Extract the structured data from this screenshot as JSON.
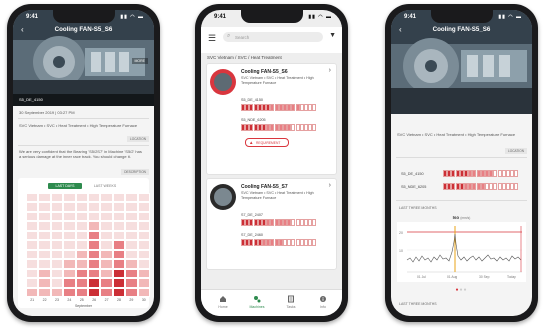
{
  "status": {
    "time": "9:41",
    "icons": "▮▮ ◠ ▬"
  },
  "colors": {
    "accent": "#d9363e",
    "light_red": "#f2b8b8",
    "mid_red": "#e87f84",
    "dark_red": "#cc2f36",
    "green": "#2e8b4e"
  },
  "phone1": {
    "title": "Cooling FAN-S5_S6",
    "back": "‹",
    "more": "MORE",
    "photo_caption": "S5_DE_4150",
    "date": "30 September 2019 | 03:27 PM",
    "location_text": "SVC Vietnam • SVC • Heat Treatment • High Temperature Furnace",
    "location_btn": "LOCATION",
    "desc_text": "We are very confident that the Bearing 'S5/2S7' in Machine 'S5/2' has a serious damage at the inner race track. You should change it.",
    "desc_btn": "DESCRIPTION",
    "tabs": [
      "LAST DAYS",
      "LAST WEEKS"
    ],
    "x_labels": [
      "21",
      "22",
      "23",
      "24",
      "25",
      "26",
      "27",
      "28",
      "29",
      "30"
    ],
    "x_title": "September",
    "heat_columns": [
      [
        0,
        0,
        0,
        0,
        0,
        0,
        0,
        0,
        0,
        0,
        1
      ],
      [
        0,
        0,
        0,
        0,
        0,
        0,
        0,
        0,
        1,
        1,
        1
      ],
      [
        0,
        0,
        0,
        0,
        0,
        0,
        0,
        0,
        0,
        0,
        1
      ],
      [
        0,
        0,
        0,
        0,
        0,
        0,
        0,
        1,
        1,
        2,
        2
      ],
      [
        0,
        0,
        0,
        0,
        0,
        0,
        1,
        1,
        2,
        2,
        2
      ],
      [
        0,
        0,
        0,
        1,
        2,
        2,
        2,
        2,
        2,
        3,
        3
      ],
      [
        0,
        0,
        0,
        0,
        0,
        0,
        1,
        1,
        1,
        2,
        2
      ],
      [
        0,
        0,
        0,
        0,
        0,
        2,
        2,
        2,
        3,
        3,
        3
      ],
      [
        0,
        0,
        0,
        0,
        0,
        0,
        0,
        1,
        2,
        2,
        2
      ],
      [
        0,
        0,
        0,
        0,
        0,
        0,
        0,
        0,
        1,
        1,
        1
      ]
    ]
  },
  "phone2": {
    "search_placeholder": "Search",
    "breadcrumb": "SVC Vietnam / SVC / Heat Treatment",
    "card1": {
      "title": "Cooling FAN-S5_S6",
      "location": "SVC Vietnam • SVC • Heat Treatment • High Temperature Furnace",
      "rows": [
        {
          "label": "S5_DE_4150",
          "filled": 14,
          "total": 18
        },
        {
          "label": "S5_NDE_6205",
          "filled": 12,
          "total": 18
        }
      ],
      "alert": "REQUIREMENT"
    },
    "card2": {
      "title": "Cooling FAN-S5_S7",
      "location": "SVC Vietnam • SVC • Heat Treatment • High Temperature Furnace",
      "rows": [
        {
          "label": "S7_DE_2407",
          "filled": 12,
          "total": 18
        },
        {
          "label": "S7_DE_2460",
          "filled": 10,
          "total": 18
        }
      ]
    },
    "nav": [
      "Home",
      "Machines",
      "Tasks",
      "Info"
    ]
  },
  "phone3": {
    "title": "Cooling FAN-S5_S6",
    "back": "‹",
    "location_text": "SVC Vietnam • SVC • Heat Treatment • High Temperature Furnace",
    "location_btn": "LOCATION",
    "rows": [
      {
        "label": "S5_DE_4150",
        "filled": 12,
        "total": 18
      },
      {
        "label": "S5_NDE_6205",
        "filled": 10,
        "total": 18
      }
    ],
    "section1": "LAST THREE MONTHS",
    "chart_title": "Iso",
    "chart_unit": "(mm/s)",
    "y_ticks": [
      "20",
      "10"
    ],
    "x_ticks": [
      "01 Jul",
      "01 Aug",
      "30 Sep",
      "Today"
    ],
    "section2": "LAST THREE MONTHS"
  }
}
